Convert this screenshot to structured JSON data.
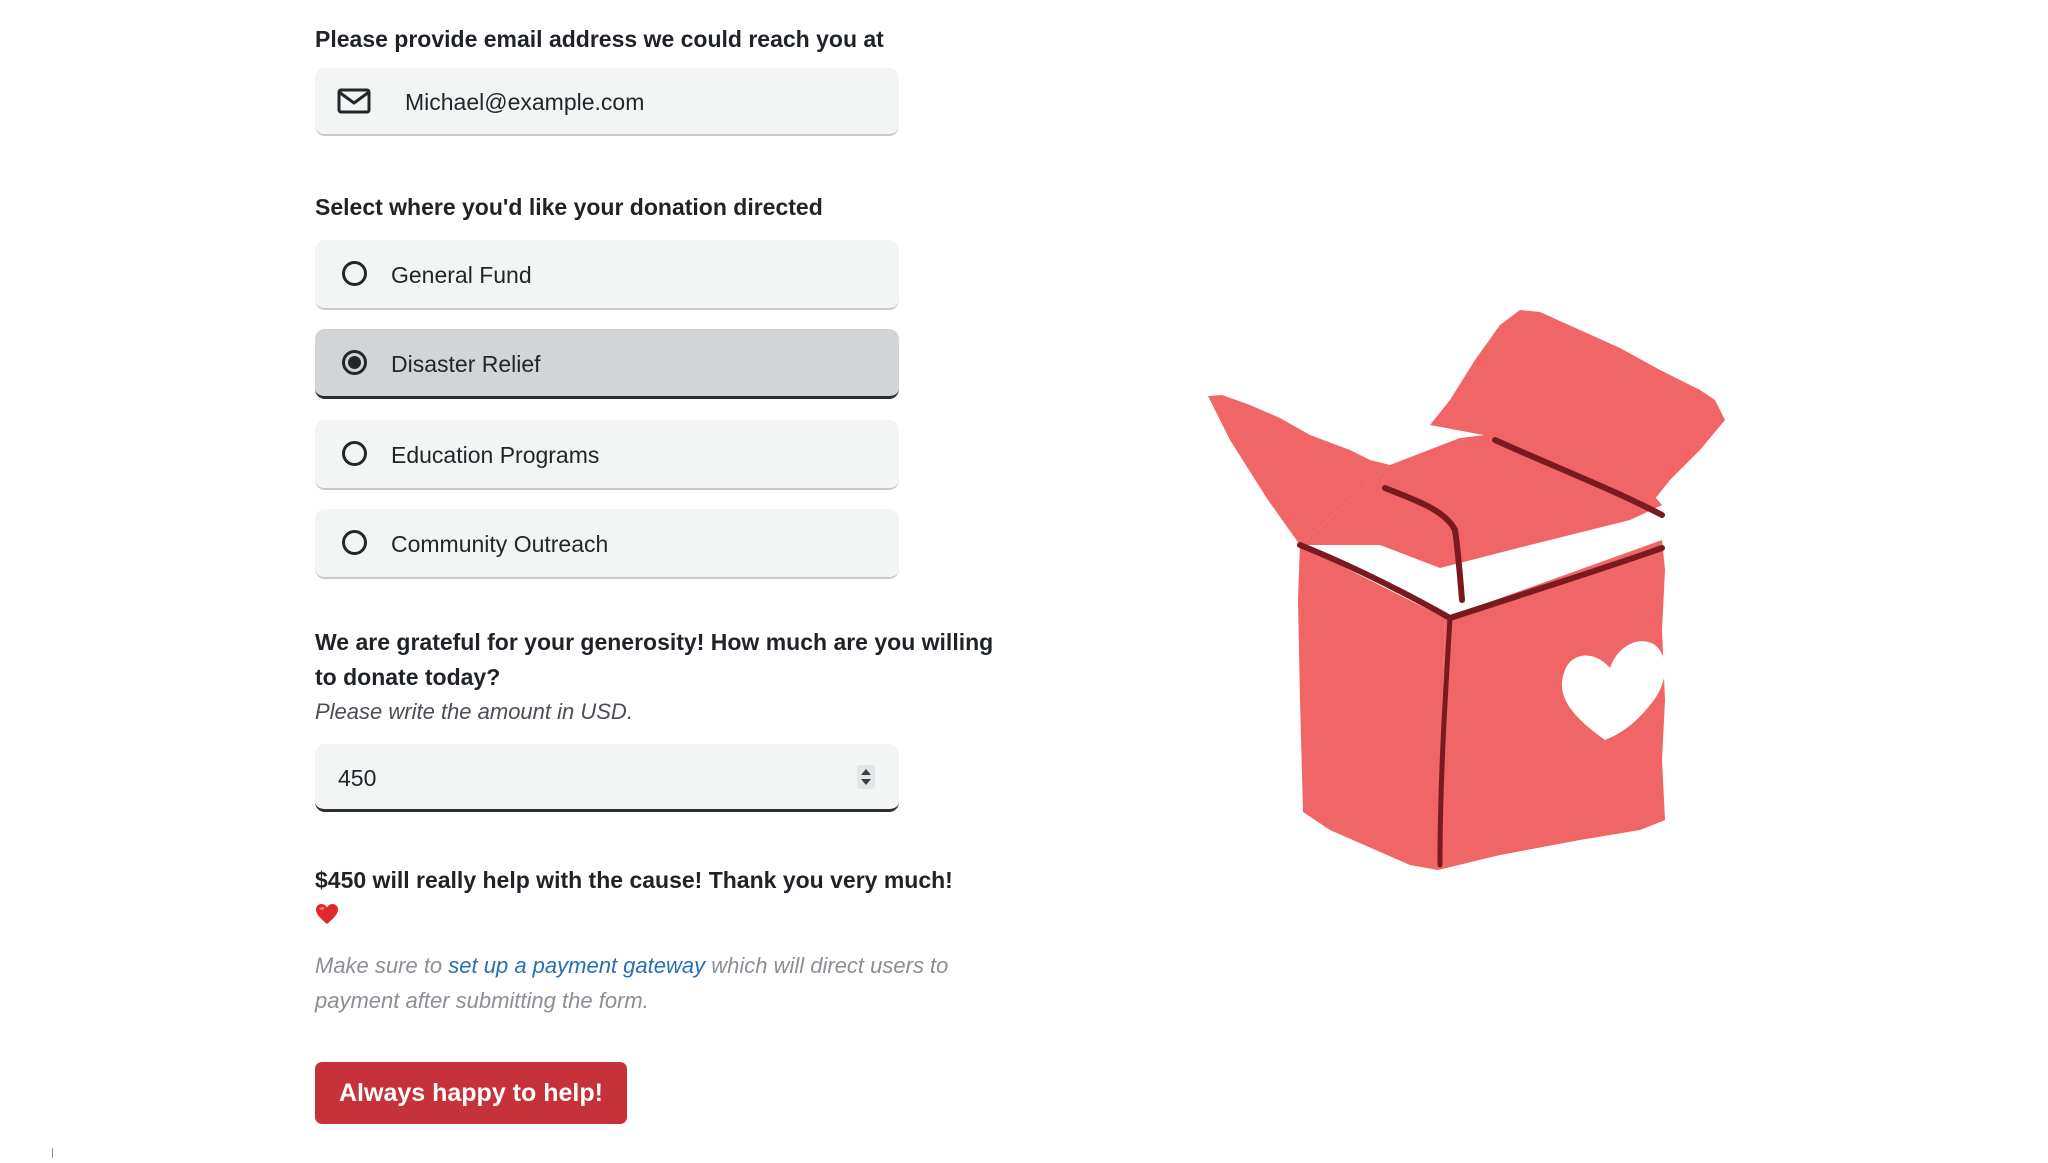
{
  "email": {
    "label": "Please provide email address we could reach you at",
    "value": "Michael@example.com",
    "icon": "envelope-icon"
  },
  "destination": {
    "label": "Select where you'd like your donation directed",
    "options": [
      {
        "label": "General Fund",
        "selected": false
      },
      {
        "label": "Disaster Relief",
        "selected": true
      },
      {
        "label": "Education Programs",
        "selected": false
      },
      {
        "label": "Community Outreach",
        "selected": false
      }
    ]
  },
  "amount": {
    "question": "We are grateful for your generosity! How much are you willing to donate today?",
    "hint": "Please write the amount in USD.",
    "value": "450"
  },
  "thanks": {
    "message": "$450 will really help with the cause! Thank you very much!",
    "emoji": "red-heart-icon"
  },
  "note": {
    "before": "Make sure to ",
    "link": "set up a payment gateway",
    "after": " which will direct users to payment after submitting the form."
  },
  "submit": {
    "label": "Always happy to help!"
  },
  "illustration": {
    "name": "open-box-with-heart",
    "box_color": "#f06565",
    "line_color": "#7a1a1f",
    "heart_color": "#ffffff"
  },
  "colors": {
    "accent": "#c7313a",
    "link": "#2a6fb3",
    "field_bg": "#f3f4f4",
    "selected_bg": "#d3d4d6"
  }
}
